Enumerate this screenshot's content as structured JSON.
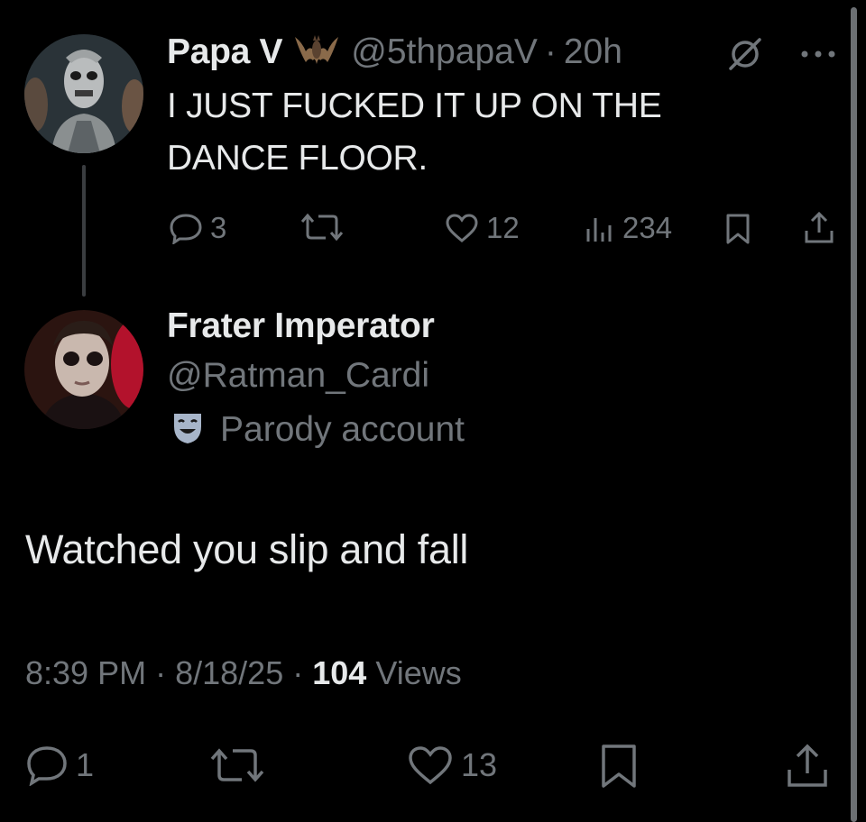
{
  "parent_tweet": {
    "name": "Papa V",
    "handle": "@5thpapaV",
    "separator": "·",
    "time": "20h",
    "text_line1": "I JUST FUCKED IT UP ON THE",
    "text_line2": "DANCE FLOOR.",
    "replies": "3",
    "likes": "12",
    "views": "234",
    "name_emoji_icon": "bat-icon",
    "badge_icon": "no-symbol-icon"
  },
  "reply_tweet": {
    "name": "Frater Imperator",
    "handle": "@Ratman_Cardi",
    "label": "Parody account",
    "label_icon": "theater-mask-icon",
    "text": "Watched you slip and fall",
    "time": "8:39 PM",
    "date": "8/18/25",
    "separator": "·",
    "views_count": "104",
    "views_label": "Views",
    "replies": "1",
    "likes": "13"
  },
  "colors": {
    "background": "#000000",
    "text": "#e7e9ea",
    "muted": "#71767b"
  }
}
